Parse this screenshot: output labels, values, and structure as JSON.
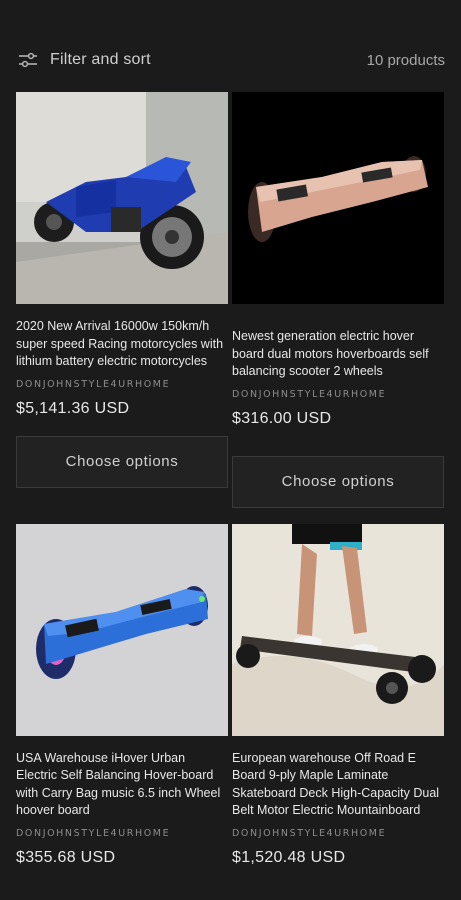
{
  "filter": {
    "label": "Filter and sort",
    "icon": "sliders-icon"
  },
  "product_count": "10 products",
  "products": [
    {
      "title": "2020 New Arrival 16000w 150km/h super speed Racing motorcycles with lithium battery electric motorcycles",
      "vendor": "DONJOHNSTYLE4URHOME",
      "price": "$5,141.36 USD",
      "button": "Choose options"
    },
    {
      "title": "Newest generation electric hover board dual motors hoverboards self balancing scooter 2 wheels",
      "vendor": "DONJOHNSTYLE4URHOME",
      "price": "$316.00 USD",
      "button": "Choose options"
    },
    {
      "title": "USA Warehouse iHover Urban Electric Self Balancing Hover-board with Carry Bag music 6.5 inch Wheel hoover board",
      "vendor": "DONJOHNSTYLE4URHOME",
      "price": "$355.68 USD"
    },
    {
      "title": "European warehouse Off Road E Board 9-ply Maple Laminate Skateboard Deck High-Capacity Dual Belt Motor Electric Mountainboard",
      "vendor": "DONJOHNSTYLE4URHOME",
      "price": "$1,520.48 USD"
    }
  ]
}
